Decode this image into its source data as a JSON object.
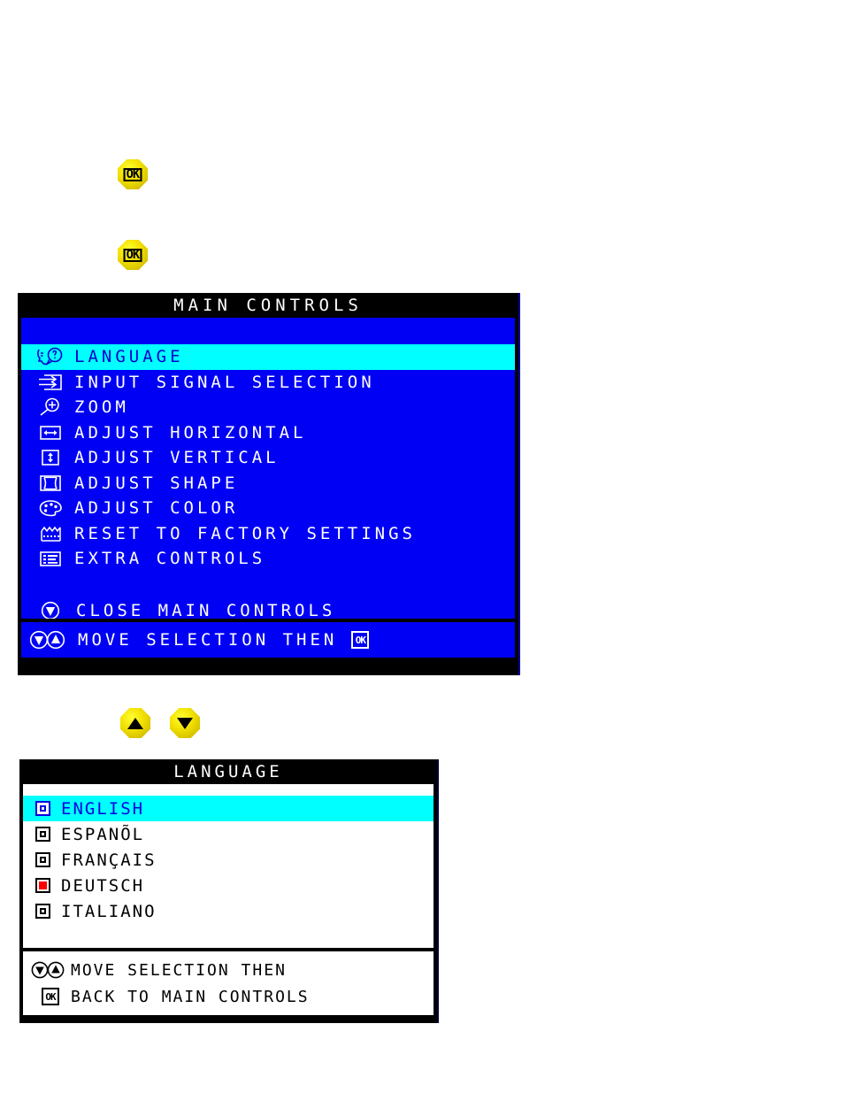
{
  "buttons": [
    {
      "name": "ok-button-1",
      "icon": "ok-octagon-icon",
      "label": "OK"
    },
    {
      "name": "ok-button-2",
      "icon": "ok-octagon-icon",
      "label": "OK"
    },
    {
      "name": "up-button",
      "icon": "up-triangle-octagon-icon",
      "label": ""
    },
    {
      "name": "down-button",
      "icon": "down-triangle-octagon-icon",
      "label": ""
    }
  ],
  "main_controls": {
    "title": "MAIN CONTROLS",
    "items": [
      {
        "icon": "language-face-icon",
        "label": "LANGUAGE",
        "selected": true
      },
      {
        "icon": "input-signal-icon",
        "label": "INPUT SIGNAL SELECTION",
        "selected": false
      },
      {
        "icon": "zoom-magnifier-icon",
        "label": "ZOOM",
        "selected": false
      },
      {
        "icon": "adjust-horizontal-icon",
        "label": "ADJUST HORIZONTAL",
        "selected": false
      },
      {
        "icon": "adjust-vertical-icon",
        "label": "ADJUST VERTICAL",
        "selected": false
      },
      {
        "icon": "adjust-shape-icon",
        "label": "ADJUST SHAPE",
        "selected": false
      },
      {
        "icon": "adjust-color-palette-icon",
        "label": "ADJUST COLOR",
        "selected": false
      },
      {
        "icon": "factory-reset-icon",
        "label": "RESET TO FACTORY SETTINGS",
        "selected": false
      },
      {
        "icon": "extra-controls-icon",
        "label": "EXTRA CONTROLS",
        "selected": false
      }
    ],
    "close_item": {
      "icon": "close-down-arrow-icon",
      "label": "CLOSE MAIN CONTROLS"
    },
    "footer": {
      "icons": "down-up-arrow-icons",
      "text": "MOVE SELECTION THEN",
      "ok_glyph": "OK"
    },
    "colors": {
      "background": "#0000f5",
      "highlight": "#00ffff",
      "title_background": "#000000",
      "text": "#ffffff",
      "highlight_text": "#0000d0"
    }
  },
  "language_menu": {
    "title": "LANGUAGE",
    "items": [
      {
        "label": "ENGLISH",
        "selected": true,
        "radio_on": false
      },
      {
        "label": "ESPANÕL",
        "selected": false,
        "radio_on": false
      },
      {
        "label": "FRANÇAIS",
        "selected": false,
        "radio_on": false
      },
      {
        "label": "DEUTSCH",
        "selected": false,
        "radio_on": true
      },
      {
        "label": "ITALIANO",
        "selected": false,
        "radio_on": false
      }
    ],
    "footer": {
      "line1_icons": "down-up-arrow-icons",
      "line1_text": "MOVE SELECTION THEN",
      "line2_ok_glyph": "OK",
      "line2_text": "BACK TO MAIN CONTROLS"
    },
    "colors": {
      "background": "#ffffff",
      "highlight": "#00ffff",
      "title_background": "#000000",
      "text": "#000000",
      "highlight_text": "#0000e0",
      "active_radio": "#ff0000"
    }
  }
}
